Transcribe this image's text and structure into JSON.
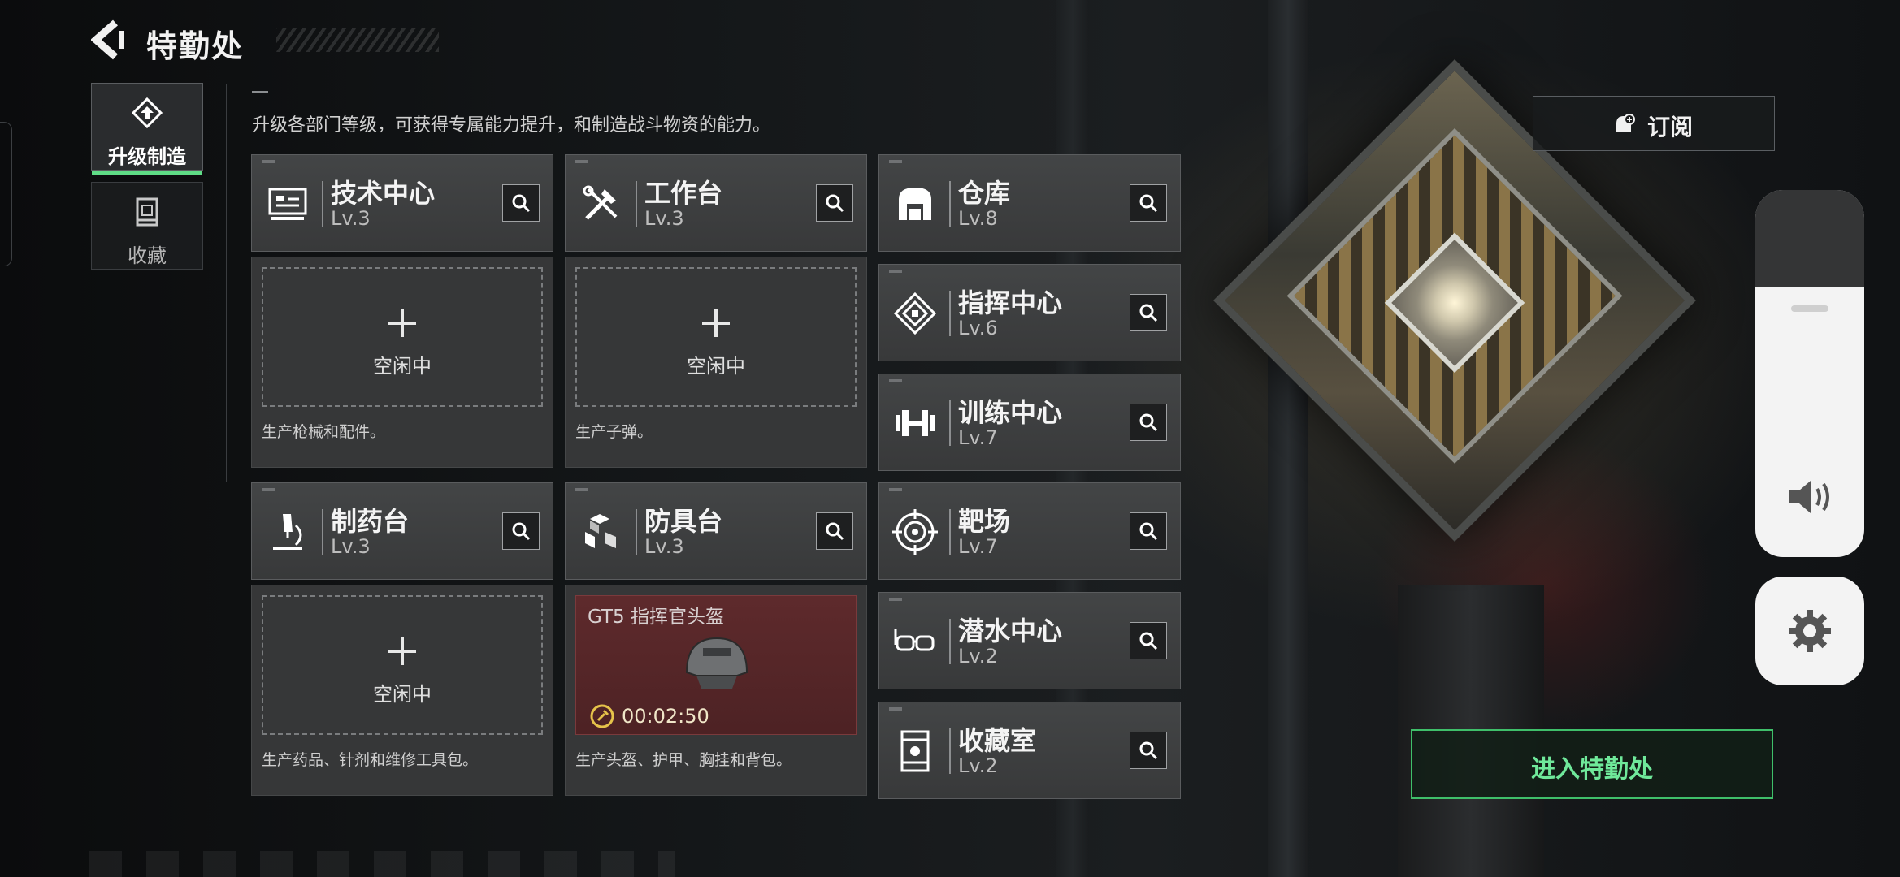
{
  "header": {
    "title": "特勤处"
  },
  "tabs": [
    {
      "label": "升级制造",
      "icon": "upgrade-icon",
      "active": true
    },
    {
      "label": "收藏",
      "icon": "collection-icon",
      "active": false
    }
  ],
  "description": "升级各部门等级，可获得专属能力提升，和制造战斗物资的能力。",
  "subscribe": {
    "label": "订阅",
    "icon": "bell-icon"
  },
  "enter_button": {
    "label": "进入特勤处"
  },
  "accent_color": "#5fdc86",
  "workstations": [
    {
      "name": "技术中心",
      "level": "Lv.3",
      "icon": "monitor-icon",
      "status": "空闲中",
      "desc": "生产枪械和配件。"
    },
    {
      "name": "工作台",
      "level": "Lv.3",
      "icon": "tools-icon",
      "status": "空闲中",
      "desc": "生产子弹。"
    },
    {
      "name": "制药台",
      "level": "Lv.3",
      "icon": "microscope-icon",
      "status": "空闲中",
      "desc": "生产药品、针剂和维修工具包。"
    },
    {
      "name": "防具台",
      "level": "Lv.3",
      "icon": "armor-boxes-icon",
      "crafting": {
        "item": "GT5 指挥官头盔",
        "timer": "00:02:50"
      },
      "desc": "生产头盔、护甲、胸挂和背包。"
    }
  ],
  "facilities": [
    {
      "name": "仓库",
      "level": "Lv.8",
      "icon": "warehouse-icon"
    },
    {
      "name": "指挥中心",
      "level": "Lv.6",
      "icon": "command-icon"
    },
    {
      "name": "训练中心",
      "level": "Lv.7",
      "icon": "dumbbell-icon"
    },
    {
      "name": "靶场",
      "level": "Lv.7",
      "icon": "target-icon"
    },
    {
      "name": "潜水中心",
      "level": "Lv.2",
      "icon": "diving-mask-icon"
    },
    {
      "name": "收藏室",
      "level": "Lv.2",
      "icon": "collection-room-icon"
    }
  ],
  "system_overlay": {
    "volume_icon": "speaker-icon",
    "settings_icon": "gear-icon"
  }
}
